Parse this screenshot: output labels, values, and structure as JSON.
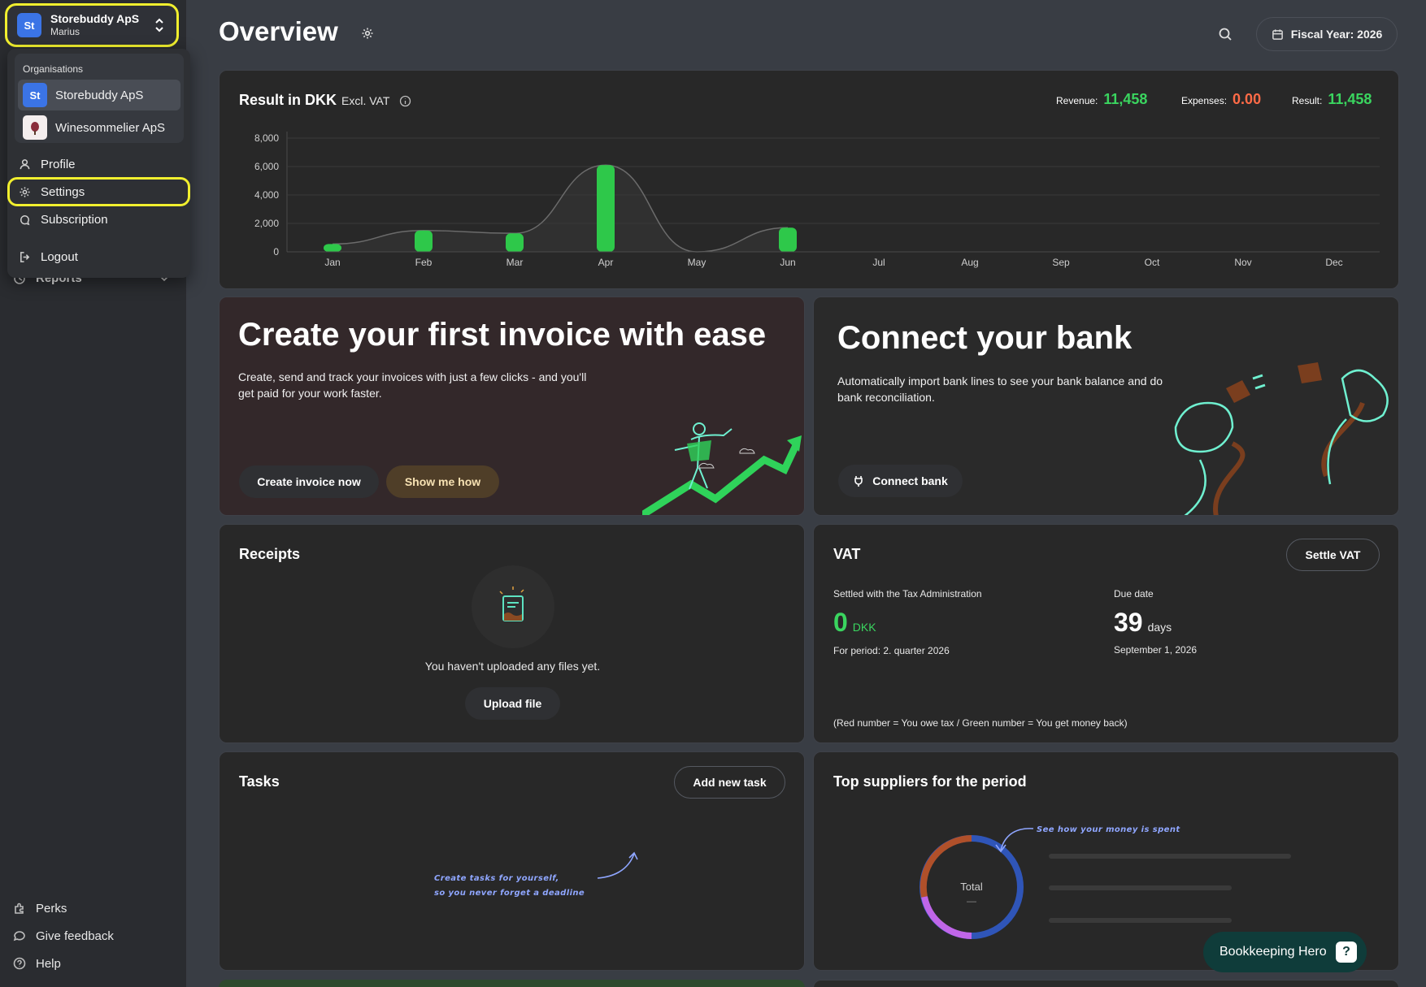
{
  "org_switcher": {
    "initials": "St",
    "name": "Storebuddy ApS",
    "user": "Marius"
  },
  "menu": {
    "org_header": "Organisations",
    "orgs": [
      {
        "initials": "St",
        "name": "Storebuddy ApS"
      },
      {
        "name": "Winesommelier ApS"
      }
    ],
    "items": {
      "profile": "Profile",
      "settings": "Settings",
      "subscription": "Subscription",
      "logout": "Logout"
    }
  },
  "sidebar": {
    "reports": "Reports",
    "bottom": {
      "perks": "Perks",
      "feedback": "Give feedback",
      "help": "Help"
    }
  },
  "header": {
    "title": "Overview",
    "fiscal_year": "Fiscal Year: 2026"
  },
  "result_card": {
    "title": "Result in DKK",
    "subtitle": "Excl. VAT",
    "revenue_label": "Revenue:",
    "revenue_value": "11,458",
    "expenses_label": "Expenses:",
    "expenses_value": "0.00",
    "result_label": "Result:",
    "result_value": "11,458"
  },
  "chart_data": {
    "type": "bar",
    "categories": [
      "Jan",
      "Feb",
      "Mar",
      "Apr",
      "May",
      "Jun",
      "Jul",
      "Aug",
      "Sep",
      "Oct",
      "Nov",
      "Dec"
    ],
    "values": [
      550,
      1500,
      1300,
      6100,
      0,
      1700,
      0,
      0,
      0,
      0,
      0,
      0
    ],
    "yticks": [
      "8,000",
      "6,000",
      "4,000",
      "2,000",
      "0"
    ],
    "ylim": [
      0,
      8000
    ],
    "grid": true,
    "colors": {
      "bar": "#2ec84a",
      "line": "#6b6b6b"
    }
  },
  "invoice_promo": {
    "title": "Create your first invoice with ease",
    "text": "Create, send and track your invoices with just a few clicks - and you'll get paid for your work faster.",
    "primary_btn": "Create invoice now",
    "secondary_btn": "Show me how"
  },
  "bank_promo": {
    "title": "Connect your bank",
    "text": "Automatically import bank lines to see your bank balance and do bank reconciliation.",
    "btn": "Connect bank"
  },
  "receipts": {
    "title": "Receipts",
    "empty": "You haven't uploaded any files yet.",
    "btn": "Upload file"
  },
  "vat": {
    "title": "VAT",
    "btn": "Settle VAT",
    "settled_label": "Settled with the Tax Administration",
    "settled_value": "0",
    "settled_unit": "DKK",
    "period": "For period: 2. quarter 2026",
    "due_label": "Due date",
    "due_value": "39",
    "due_unit": "days",
    "due_date": "September 1, 2026",
    "note": "(Red number = You owe tax / Green number = You get money back)"
  },
  "tasks": {
    "title": "Tasks",
    "btn": "Add new task",
    "hint_line1": "Create tasks for yourself,",
    "hint_line2": "so you never forget a deadline"
  },
  "suppliers": {
    "title": "Top suppliers for the period",
    "hint": "See how your money is spent",
    "donut_label": "Total",
    "donut_value": "—"
  },
  "assistant": {
    "label": "Bookkeeping Hero",
    "icon": "hero-icon"
  }
}
